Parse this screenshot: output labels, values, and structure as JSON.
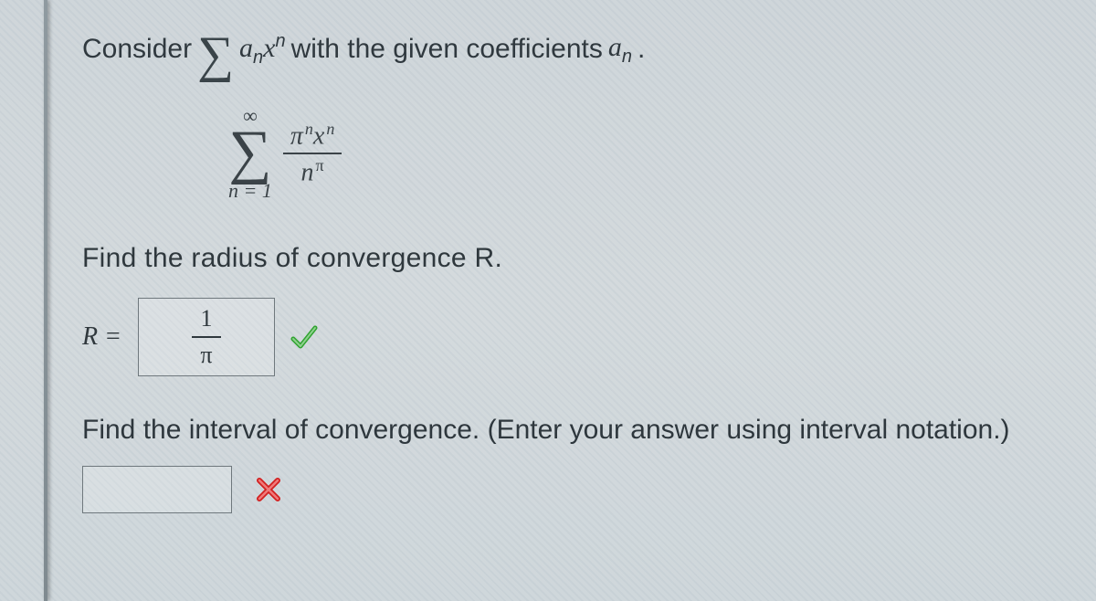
{
  "line1": {
    "prefix": "Consider",
    "series_expr": "∑ aₙxⁿ",
    "suffix": "with the given coefficients",
    "coeff_symbol": "aₙ",
    "period": "."
  },
  "series": {
    "upper": "∞",
    "lower": "n = 1",
    "numerator": "πⁿxⁿ",
    "denominator": "nπ"
  },
  "q1": {
    "prompt": "Find the radius of convergence R.",
    "label": "R =",
    "answer_numer": "1",
    "answer_denom": "π",
    "correct": true
  },
  "q2": {
    "prompt": "Find the interval of convergence. (Enter your answer using interval notation.)",
    "answer": "",
    "correct": false
  }
}
